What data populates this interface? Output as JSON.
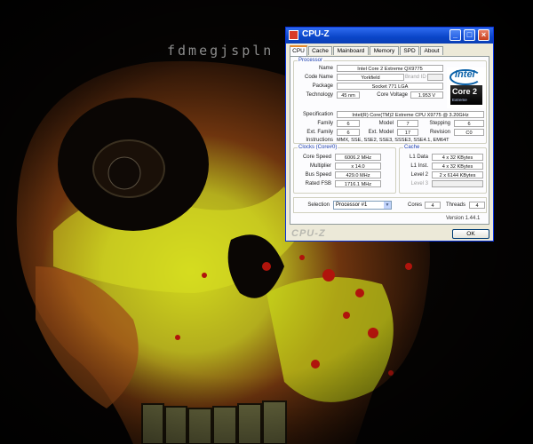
{
  "wallpaper": {
    "logo_text": "fdmegjspln"
  },
  "window": {
    "title": "CPU-Z",
    "tabs": [
      "CPU",
      "Cache",
      "Mainboard",
      "Memory",
      "SPD",
      "About"
    ],
    "active_tab": "CPU"
  },
  "processor": {
    "group_title": "Processor",
    "name_label": "Name",
    "name": "Intel Core 2 Extreme QX9775",
    "code_name_label": "Code Name",
    "code_name": "Yorkfield",
    "brand_id_label": "Brand ID",
    "package_label": "Package",
    "package": "Socket 771 LGA",
    "technology_label": "Technology",
    "technology": "45 nm",
    "core_voltage_label": "Core Voltage",
    "core_voltage": "1.953 V",
    "specification_label": "Specification",
    "specification": "Intel(R) Core(TM)2 Extreme CPU X9775 @ 3.20GHz",
    "family_label": "Family",
    "family": "6",
    "model_label": "Model",
    "model": "7",
    "stepping_label": "Stepping",
    "stepping": "6",
    "ext_family_label": "Ext. Family",
    "ext_family": "6",
    "ext_model_label": "Ext. Model",
    "ext_model": "17",
    "revision_label": "Revision",
    "revision": "C0",
    "instructions_label": "Instructions",
    "instructions": "MMX, SSE, SSE2, SSE3, SSSE3, SSE4.1, EM64T",
    "logo": {
      "brand": "intel",
      "badge": "Core 2",
      "badge_sub": "Extreme",
      "brand_color": "#0860a8"
    }
  },
  "clocks": {
    "group_title": "Clocks (Core#0)",
    "core_speed_label": "Core Speed",
    "core_speed": "6006.2 MHz",
    "multiplier_label": "Multiplier",
    "multiplier": "x 14.0",
    "bus_speed_label": "Bus Speed",
    "bus_speed": "429.0 MHz",
    "rated_fsb_label": "Rated FSB",
    "rated_fsb": "1716.1 MHz"
  },
  "cache": {
    "group_title": "Cache",
    "l1_data_label": "L1 Data",
    "l1_data": "4 x 32 KBytes",
    "l1_inst_label": "L1 Inst.",
    "l1_inst": "4 x 32 KBytes",
    "level2_label": "Level 2",
    "level2": "2 x 6144 KBytes",
    "level3_label": "Level 3"
  },
  "selection": {
    "label": "Selection",
    "processor": "Processor #1",
    "cores_label": "Cores",
    "cores": "4",
    "threads_label": "Threads",
    "threads": "4"
  },
  "footer": {
    "version": "Version 1.44.1",
    "logo": "CPU-Z",
    "ok_label": "OK"
  }
}
